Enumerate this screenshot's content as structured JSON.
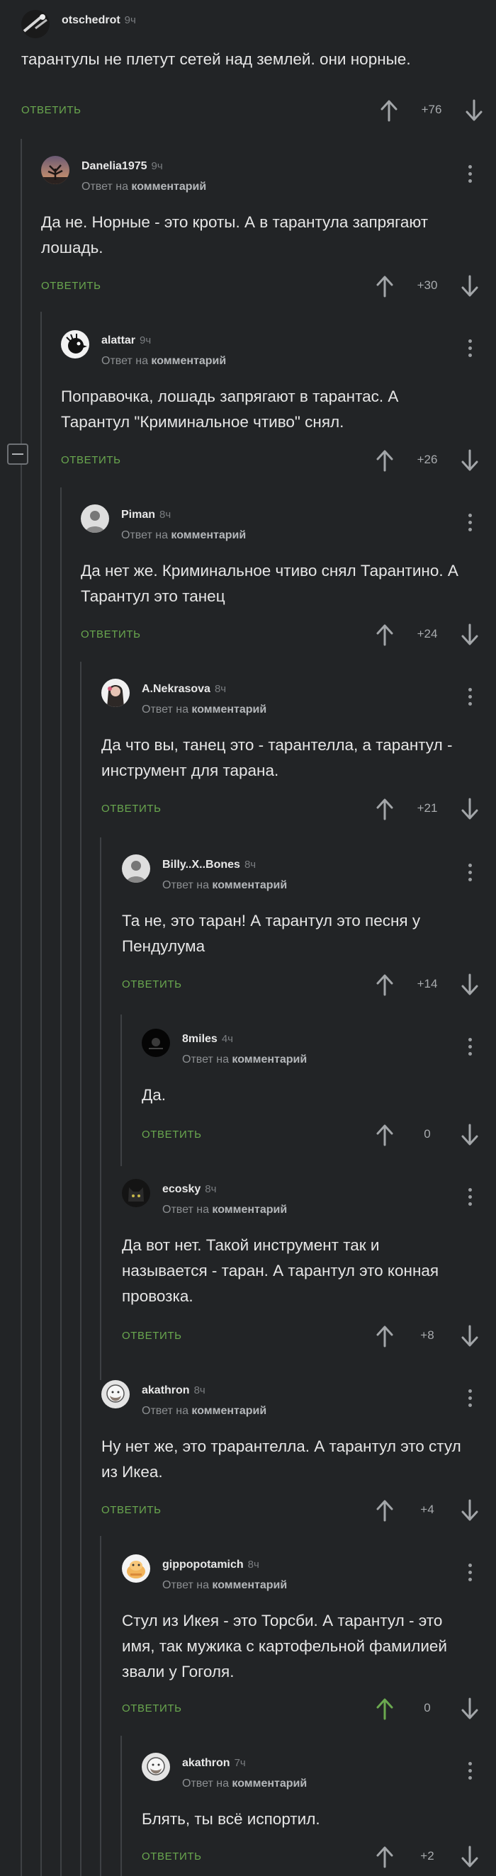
{
  "ui": {
    "reply_label": "ОТВЕТИТЬ",
    "reply_to_prefix": "Ответ на",
    "reply_to_target": "комментарий",
    "accent_green": "#6aa84f",
    "background": "#222426"
  },
  "comments": [
    {
      "author": "otschedrot",
      "time": "9ч",
      "reply_to": false,
      "text": "тарантулы не плетут сетей над землей. они норные.",
      "score": "+76",
      "voted_up": false,
      "avatar_icon": "cable-avatar-icon"
    },
    {
      "author": "Danelia1975",
      "time": "9ч",
      "reply_to": true,
      "text": "Да не. Норные - это кроты. А в тарантула запрягают лошадь.",
      "score": "+30",
      "voted_up": false,
      "avatar_icon": "tree-avatar-icon"
    },
    {
      "author": "alattar",
      "time": "9ч",
      "reply_to": true,
      "text": "Поправочка, лошадь запрягают в тарантас. А Тарантул \"Криминальное чтиво\" снял.",
      "score": "+26",
      "voted_up": false,
      "avatar_icon": "bird-avatar-icon"
    },
    {
      "author": "Piman",
      "time": "8ч",
      "reply_to": true,
      "text": "Да нет же. Криминальное чтиво снял Тарантино. А Тарантул это танец",
      "score": "+24",
      "voted_up": false,
      "avatar_icon": "person-avatar-icon"
    },
    {
      "author": "A.Nekrasova",
      "time": "8ч",
      "reply_to": true,
      "text": "Да что вы, танец это - тарантелла, а тарантул - инструмент для тарана.",
      "score": "+21",
      "voted_up": false,
      "avatar_icon": "girl-avatar-icon"
    },
    {
      "author": "Billy..X..Bones",
      "time": "8ч",
      "reply_to": true,
      "text": "Та не, это таран! А тарантул это песня у Пендулума",
      "score": "+14",
      "voted_up": false,
      "avatar_icon": "person-avatar-icon"
    },
    {
      "author": "8miles",
      "time": "4ч",
      "reply_to": true,
      "text": "Да.",
      "score": "0",
      "voted_up": false,
      "avatar_icon": "dark-avatar-icon"
    },
    {
      "author": "ecosky",
      "time": "8ч",
      "reply_to": true,
      "text": "Да вот нет. Такой инструмент так и называется - таран. А тарантул это конная провозка.",
      "score": "+8",
      "voted_up": false,
      "avatar_icon": "cat-avatar-icon"
    },
    {
      "author": "akathron",
      "time": "8ч",
      "reply_to": true,
      "text": "Ну нет же, это трарантелла. А тарантул это стул из Икеа.",
      "score": "+4",
      "voted_up": false,
      "avatar_icon": "bearded-avatar-icon"
    },
    {
      "author": "gippopotamich",
      "time": "8ч",
      "reply_to": true,
      "text": "Стул из Икея - это Торсби. А тарантул - это имя, так мужика с картофельной фамилией звали у Гоголя.",
      "score": "0",
      "voted_up": true,
      "avatar_icon": "hippo-avatar-icon"
    },
    {
      "author": "akathron",
      "time": "7ч",
      "reply_to": true,
      "text": "Блять, ты всё испортил.",
      "score": "+2",
      "voted_up": false,
      "avatar_icon": "bearded-avatar-icon"
    }
  ]
}
